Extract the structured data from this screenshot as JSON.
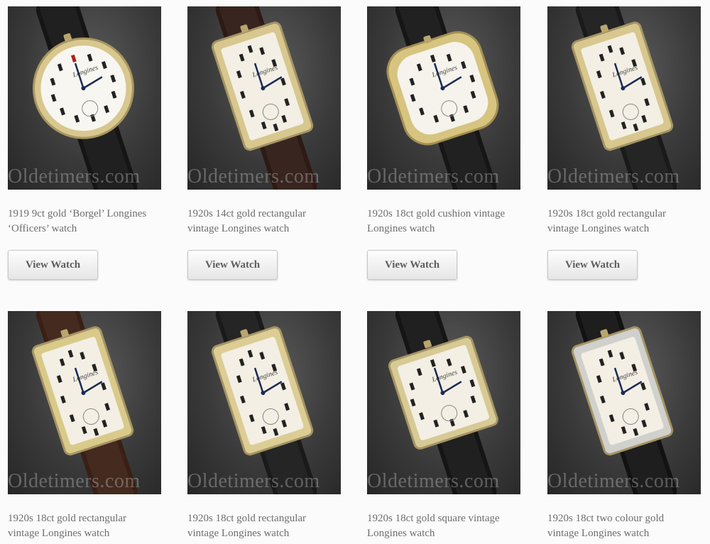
{
  "watermark": "Oldetimers.com",
  "button_label": "View Watch",
  "watches": [
    {
      "line1": "1919 9ct gold ‘Borgel’ Longines",
      "line2": "‘Officers’ watch",
      "dial_brand": "Longines",
      "case_color": "#d8c78e",
      "strap_color": "#151515",
      "shape": "round"
    },
    {
      "line1": "1920s 14ct gold rectangular",
      "line2": "vintage Longines watch",
      "dial_brand": "Longines",
      "case_color": "#d8c78e",
      "strap_color": "#2e1a14",
      "shape": "rect"
    },
    {
      "line1": "1920s 18ct gold cushion vintage",
      "line2": "Longines watch",
      "dial_brand": "Longines",
      "case_color": "#d6c47f",
      "strap_color": "#161616",
      "shape": "cushion"
    },
    {
      "line1": "1920s 18ct gold rectangular",
      "line2": "vintage Longines watch",
      "dial_brand": "Longines",
      "case_color": "#d8c78e",
      "strap_color": "#1a1a1a",
      "shape": "rect"
    },
    {
      "line1": "1920s 18ct gold rectangular",
      "line2": "vintage Longines watch",
      "dial_brand": "Longines",
      "case_color": "#d9ca8a",
      "strap_color": "#3a1f14",
      "shape": "rect"
    },
    {
      "line1": "1920s 18ct gold rectangular",
      "line2": "vintage Longines watch",
      "dial_brand": "Longines",
      "case_color": "#dccd95",
      "strap_color": "#1a1a1a",
      "shape": "rect"
    },
    {
      "line1": "1920s 18ct gold square vintage",
      "line2": "Longines watch",
      "dial_brand": "Longines",
      "case_color": "#d8ca95",
      "strap_color": "#151515",
      "shape": "square"
    },
    {
      "line1": "1920s 18ct two colour gold",
      "line2": "vintage Longines watch",
      "dial_brand": "Longines",
      "case_color": "#d0d0cc",
      "strap_color": "#121212",
      "shape": "rect"
    }
  ]
}
